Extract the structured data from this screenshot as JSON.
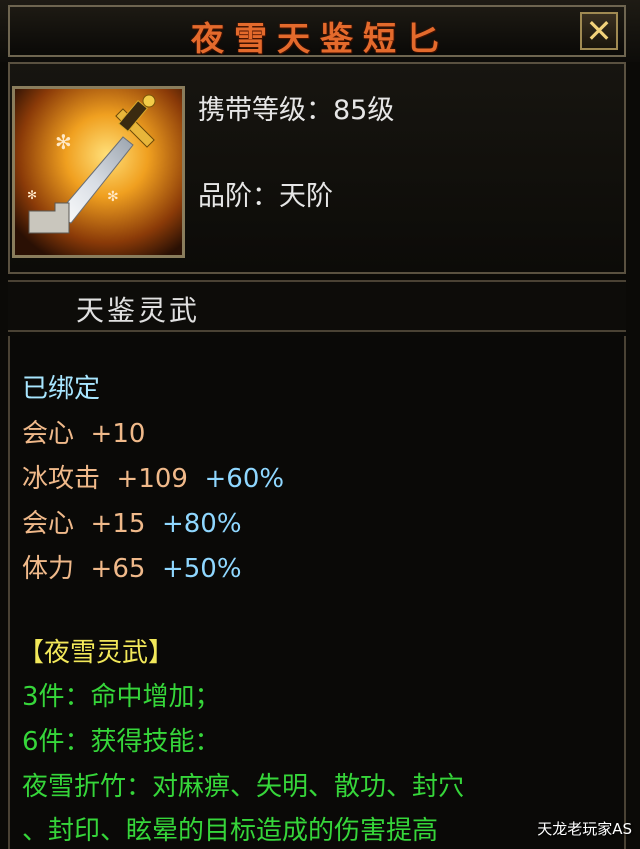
{
  "window": {
    "title": "夜雪天鉴短匕",
    "close_label": "✕"
  },
  "item": {
    "icon": "dagger-icon",
    "level_label": "携带等级：85级",
    "grade_label": "品阶：天阶",
    "type_label": "天鉴灵武"
  },
  "attributes": {
    "bound": "已绑定",
    "rows": [
      {
        "name": "会心",
        "value": "+10",
        "pct": ""
      },
      {
        "name": "冰攻击",
        "value": "+109",
        "pct": "+60%"
      },
      {
        "name": "会心",
        "value": "+15",
        "pct": "+80%"
      },
      {
        "name": "体力",
        "value": "+65",
        "pct": "+50%"
      }
    ]
  },
  "set": {
    "title": "【夜雪灵武】",
    "lines": [
      "3件：命中增加；",
      "6件：获得技能：",
      "夜雪折竹：对麻痹、失明、散功、封穴",
      "、封印、眩晕的目标造成的伤害提高"
    ]
  },
  "watermark": "天龙老玩家AS",
  "colors": {
    "title": "#e46a2c",
    "bound": "#a8e6ff",
    "attribute": "#f0b98a",
    "percent": "#8fd7ff",
    "set_title": "#f2e85a",
    "set_text": "#36d63a"
  }
}
